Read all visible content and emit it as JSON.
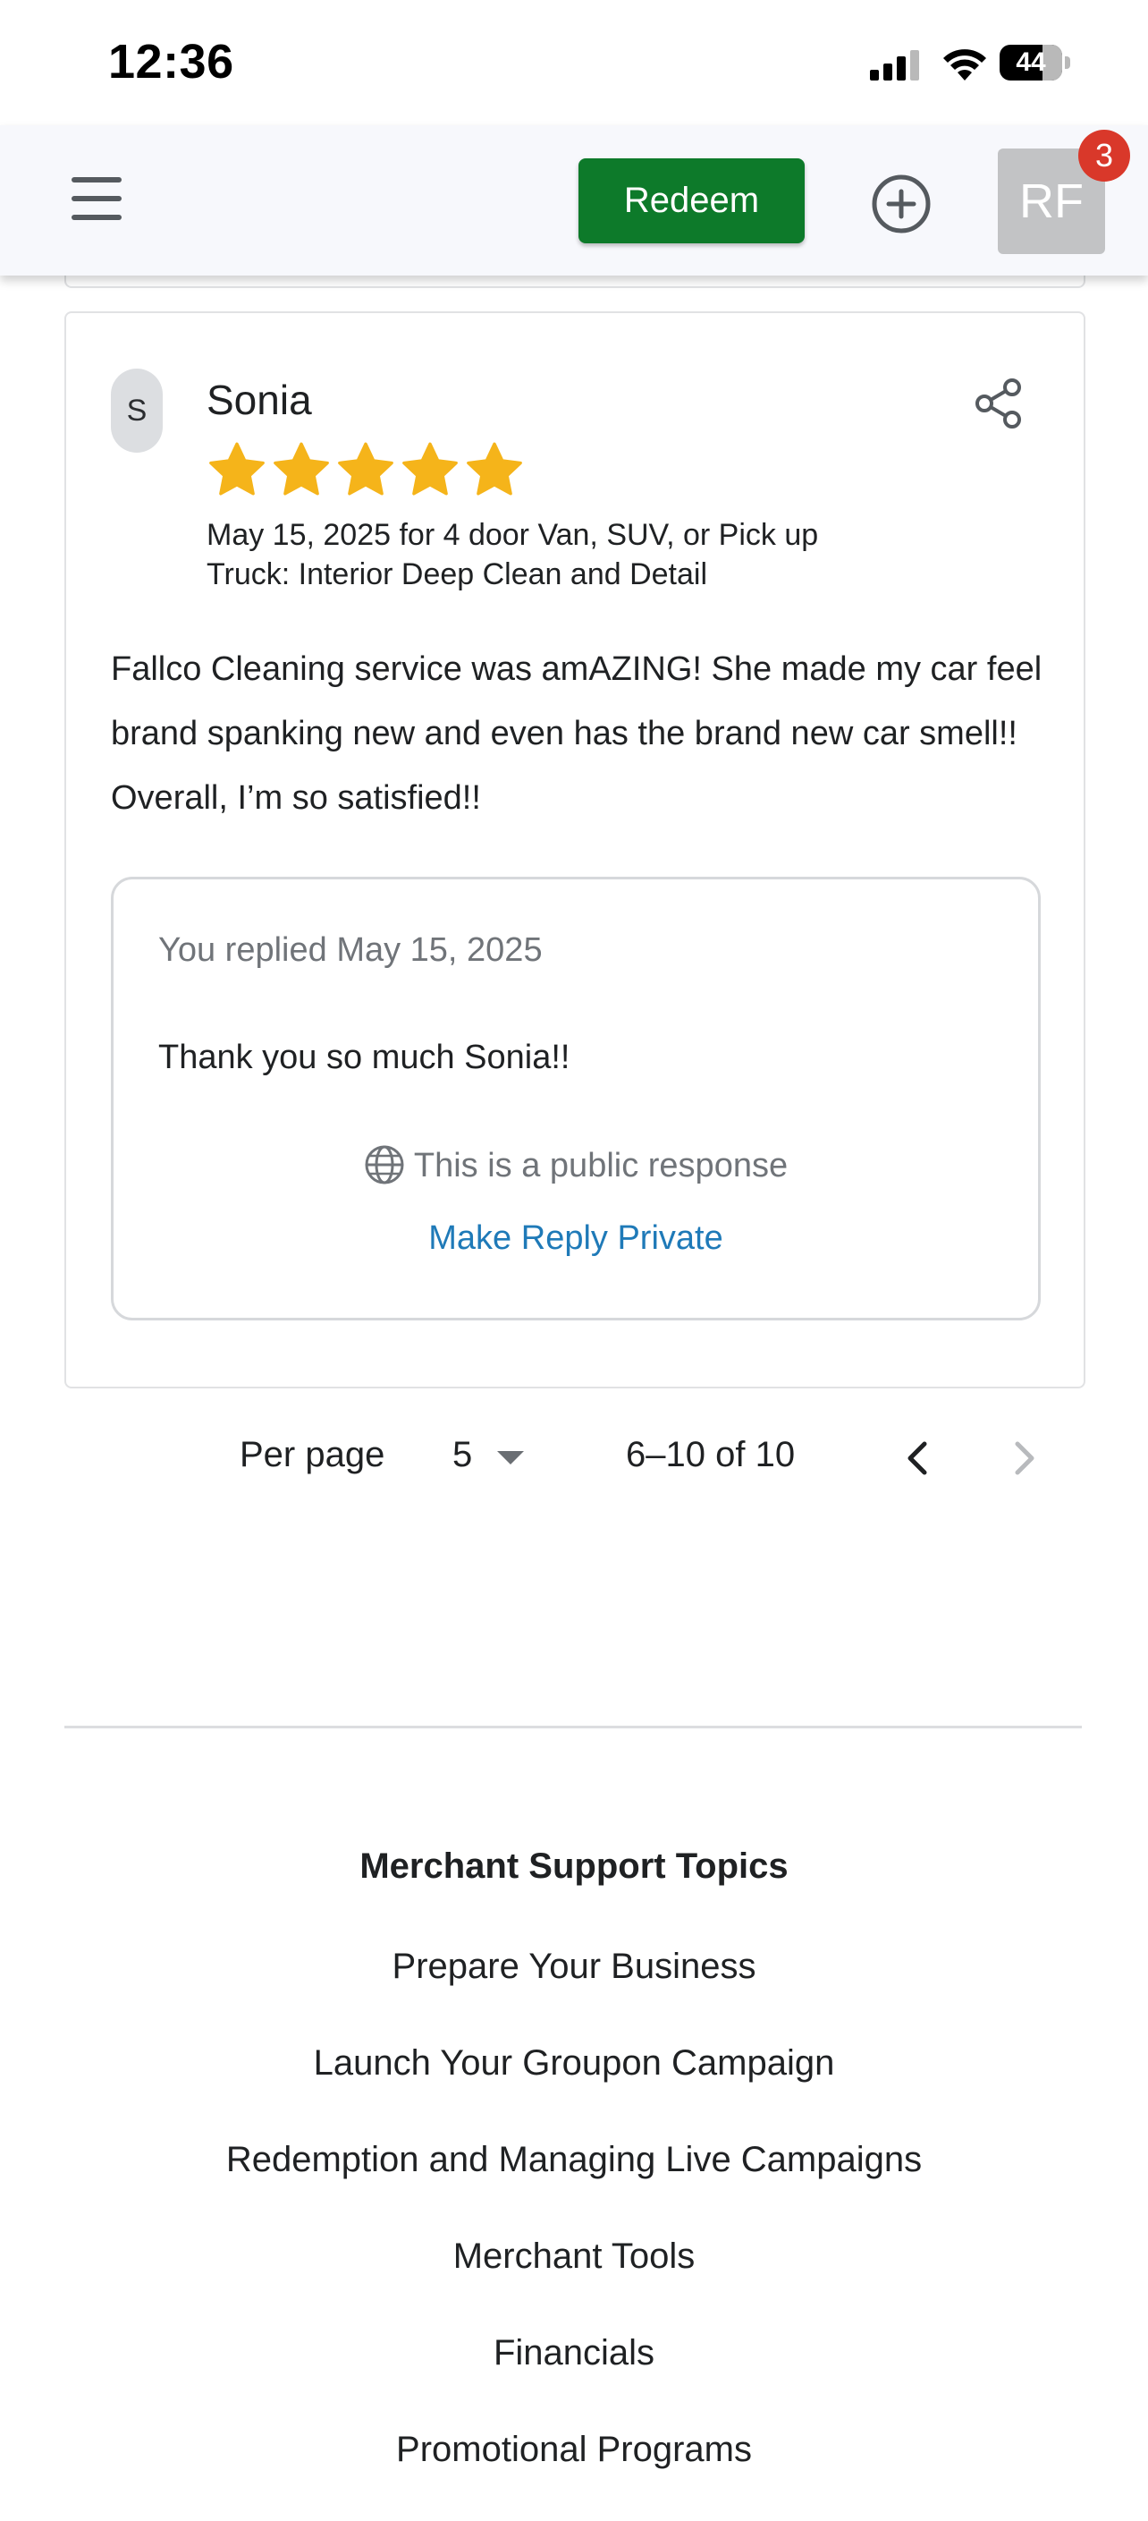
{
  "status_bar": {
    "time": "12:36",
    "battery": "44"
  },
  "header": {
    "redeem_label": "Redeem",
    "avatar_initials": "RF",
    "notification_count": "3"
  },
  "review": {
    "avatar_initial": "S",
    "reviewer_name": "Sonia",
    "rating": 5,
    "meta_line1": "May 15, 2025 for 4 door Van, SUV, or Pick up",
    "meta_line2": "Truck: Interior Deep Clean and Detail",
    "text": "Fallco Cleaning service was amAZING! She made my car feel brand spanking new and even has the brand new car smell!! Overall, I’m so satisfied!!",
    "reply": {
      "date_label": "You replied May 15, 2025",
      "text": "Thank you so much Sonia!!",
      "visibility_label": "This is a public response",
      "make_private_label": "Make Reply Private"
    }
  },
  "pagination": {
    "per_page_label": "Per page",
    "per_page_value": "5",
    "range": "6–10 of 10"
  },
  "footer": {
    "support_title": "Merchant Support Topics",
    "links": [
      "Prepare Your Business",
      "Launch Your Groupon Campaign",
      "Redemption and Managing Live Campaigns",
      "Merchant Tools",
      "Financials",
      "Promotional Programs"
    ]
  },
  "colors": {
    "accent_green": "#0d7a2a",
    "link_blue": "#1f7ab8",
    "star_gold": "#f5b41a",
    "badge_red": "#d9382a"
  }
}
